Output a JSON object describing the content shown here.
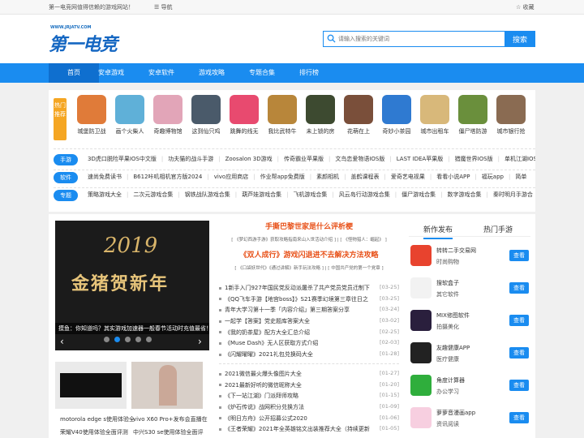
{
  "topbar": {
    "welcome": "第一电竞网值得信赖的游戏网站！",
    "nav": "导航",
    "favorite": "收藏"
  },
  "logo": {
    "url": "WWW.JRJATV.COM",
    "text": "第一电竞"
  },
  "search": {
    "placeholder": "请输入搜索的关键词",
    "button": "搜索"
  },
  "nav": [
    "首页",
    "安卓游戏",
    "安卓软件",
    "游戏攻略",
    "专题合集",
    "排行榜"
  ],
  "hot_label": "热门推荐",
  "games": [
    {
      "name": "城堡防卫战",
      "color": "#e07b39"
    },
    {
      "name": "画个火柴人",
      "color": "#5fb0d8"
    },
    {
      "name": "奇趣博物馆",
      "color": "#e2a5b8"
    },
    {
      "name": "这到仙只鸡",
      "color": "#4a5a6a"
    },
    {
      "name": "跳舞的线无",
      "color": "#e84a6f"
    },
    {
      "name": "我比武特牛",
      "color": "#b8863a"
    },
    {
      "name": "未上锁的房",
      "color": "#3d4a30"
    },
    {
      "name": "花萌在上",
      "color": "#7a4f3a"
    },
    {
      "name": "奇妙小茶园",
      "color": "#2f7ad1"
    },
    {
      "name": "城市出租车",
      "color": "#d8b87a"
    },
    {
      "name": "僵尸塔防游",
      "color": "#6a8f3c"
    },
    {
      "name": "城市银行抢",
      "color": "#8a6b52"
    }
  ],
  "rows": [
    {
      "tag": "手游",
      "links": [
        "3D虎口脱险苹果IOS中文版",
        "功夫猫的战斗手游",
        "Zoosalon 3D游戏",
        "传奇霸业苹果版",
        "文鸟恋爱物语IOS版",
        "LAST IDEA苹果版",
        "猎魔世界IOS版",
        "单机江湖IOS"
      ]
    },
    {
      "tag": "软件",
      "links": [
        "速尚免费读书",
        "B612咔叽相机官方版2024",
        "vivo应用商店",
        "作业帮app免费版",
        "素颜相机",
        "盖鹤课程表",
        "爱奇艺电视果",
        "看看小说APP",
        "福玩app",
        "简单"
      ]
    },
    {
      "tag": "专题",
      "links": [
        "策略游戏大全",
        "二次元游戏合集",
        "钢铁战队游戏合集",
        "葫芦娃游戏合集",
        "飞机游戏合集",
        "风云岛行动游戏合集",
        "僵尸游戏合集",
        "数字游戏合集",
        "秦时明月手游合"
      ]
    }
  ],
  "slider": {
    "year": "2019",
    "title": "金猪贺新年",
    "caption": "摸鱼：你知道吗？其实游戏加速器一般春节活动时充值最省！"
  },
  "thumbs": [
    {
      "caption": "motorola edge s使用体验全",
      "color": "#e8e8e8"
    },
    {
      "caption": "vivo X60 Pro+发布会直播在",
      "color": "#d8cfc8"
    },
    {
      "caption": "荣耀V40使用体验全面评测",
      "color": ""
    },
    {
      "caption": "中兴S30 se使用体验全面评",
      "color": ""
    }
  ],
  "center": {
    "headline1": "手撕巴黎世家是什么评析梗",
    "sub1": "[ 《梦幻西游手游》获取攻略指南来山入世活动介绍 ] | [ 《怪物猎人：崛起》 ]",
    "headline2": "《双人成行》游戏闪退进不去解决方法攻略",
    "sub2": "[ 《口袋妖世代》《通过讲解》新手玩法攻略 ] | [ 中国共产党的第一个党章 ]"
  },
  "news1": [
    {
      "title": "1新手入门927年国民党反动派屠杀了共产党员党员迁制下",
      "date": "03-25"
    },
    {
      "title": "《QQ飞车手游【地宫boss】》S21赛季幻境第三章往日之",
      "date": "03-25"
    },
    {
      "title": "青年大学习第十一季「内容介绍」第三期答案分享",
      "date": "03-24"
    },
    {
      "title": "一起学【答案】党史题库答案大全",
      "date": "03-02"
    },
    {
      "title": "《我的奶茶屋》配方大全汇总介绍",
      "date": "02-25"
    },
    {
      "title": "《Muse Dash》无人区获取方式介绍",
      "date": "02-03"
    },
    {
      "title": "《闪耀曜曜》2021礼包兑换码大全",
      "date": "01-28"
    }
  ],
  "news2": [
    {
      "title": "2021微信最火爆头像图片大全",
      "date": "01-27"
    },
    {
      "title": "2021最新好听的微信昵称大全",
      "date": "01-20"
    },
    {
      "title": "《下一站江湖》门派拜师攻略",
      "date": "01-15"
    },
    {
      "title": "《炉石传说》战网积分兑换方法",
      "date": "01-09"
    },
    {
      "title": "《明日方舟》公开招募公式2020",
      "date": "01-06"
    },
    {
      "title": "《王者荣耀》2021年全英雄铭文出装推荐大全（持续更新",
      "date": "01-05"
    }
  ],
  "tabs": [
    "新作发布",
    "热门手游"
  ],
  "apps": [
    {
      "name": "转转二手交易网",
      "cat": "时尚购物",
      "btn": "查看",
      "color": "#e8432e"
    },
    {
      "name": "搜软盒子",
      "cat": "其它软件",
      "btn": "查看",
      "color": "#f2f2f2"
    },
    {
      "name": "MIX修图软件",
      "cat": "拍摄美化",
      "btn": "查看",
      "color": "#2a1f3d"
    },
    {
      "name": "友趣健康APP",
      "cat": "医疗健康",
      "btn": "查看",
      "color": "#222"
    },
    {
      "name": "角度计算器",
      "cat": "办公学习",
      "btn": "查看",
      "color": "#2fae3c"
    },
    {
      "name": "萝萝音漫画app",
      "cat": "资讯阅读",
      "btn": "查看",
      "color": "#f7cfe0"
    }
  ]
}
